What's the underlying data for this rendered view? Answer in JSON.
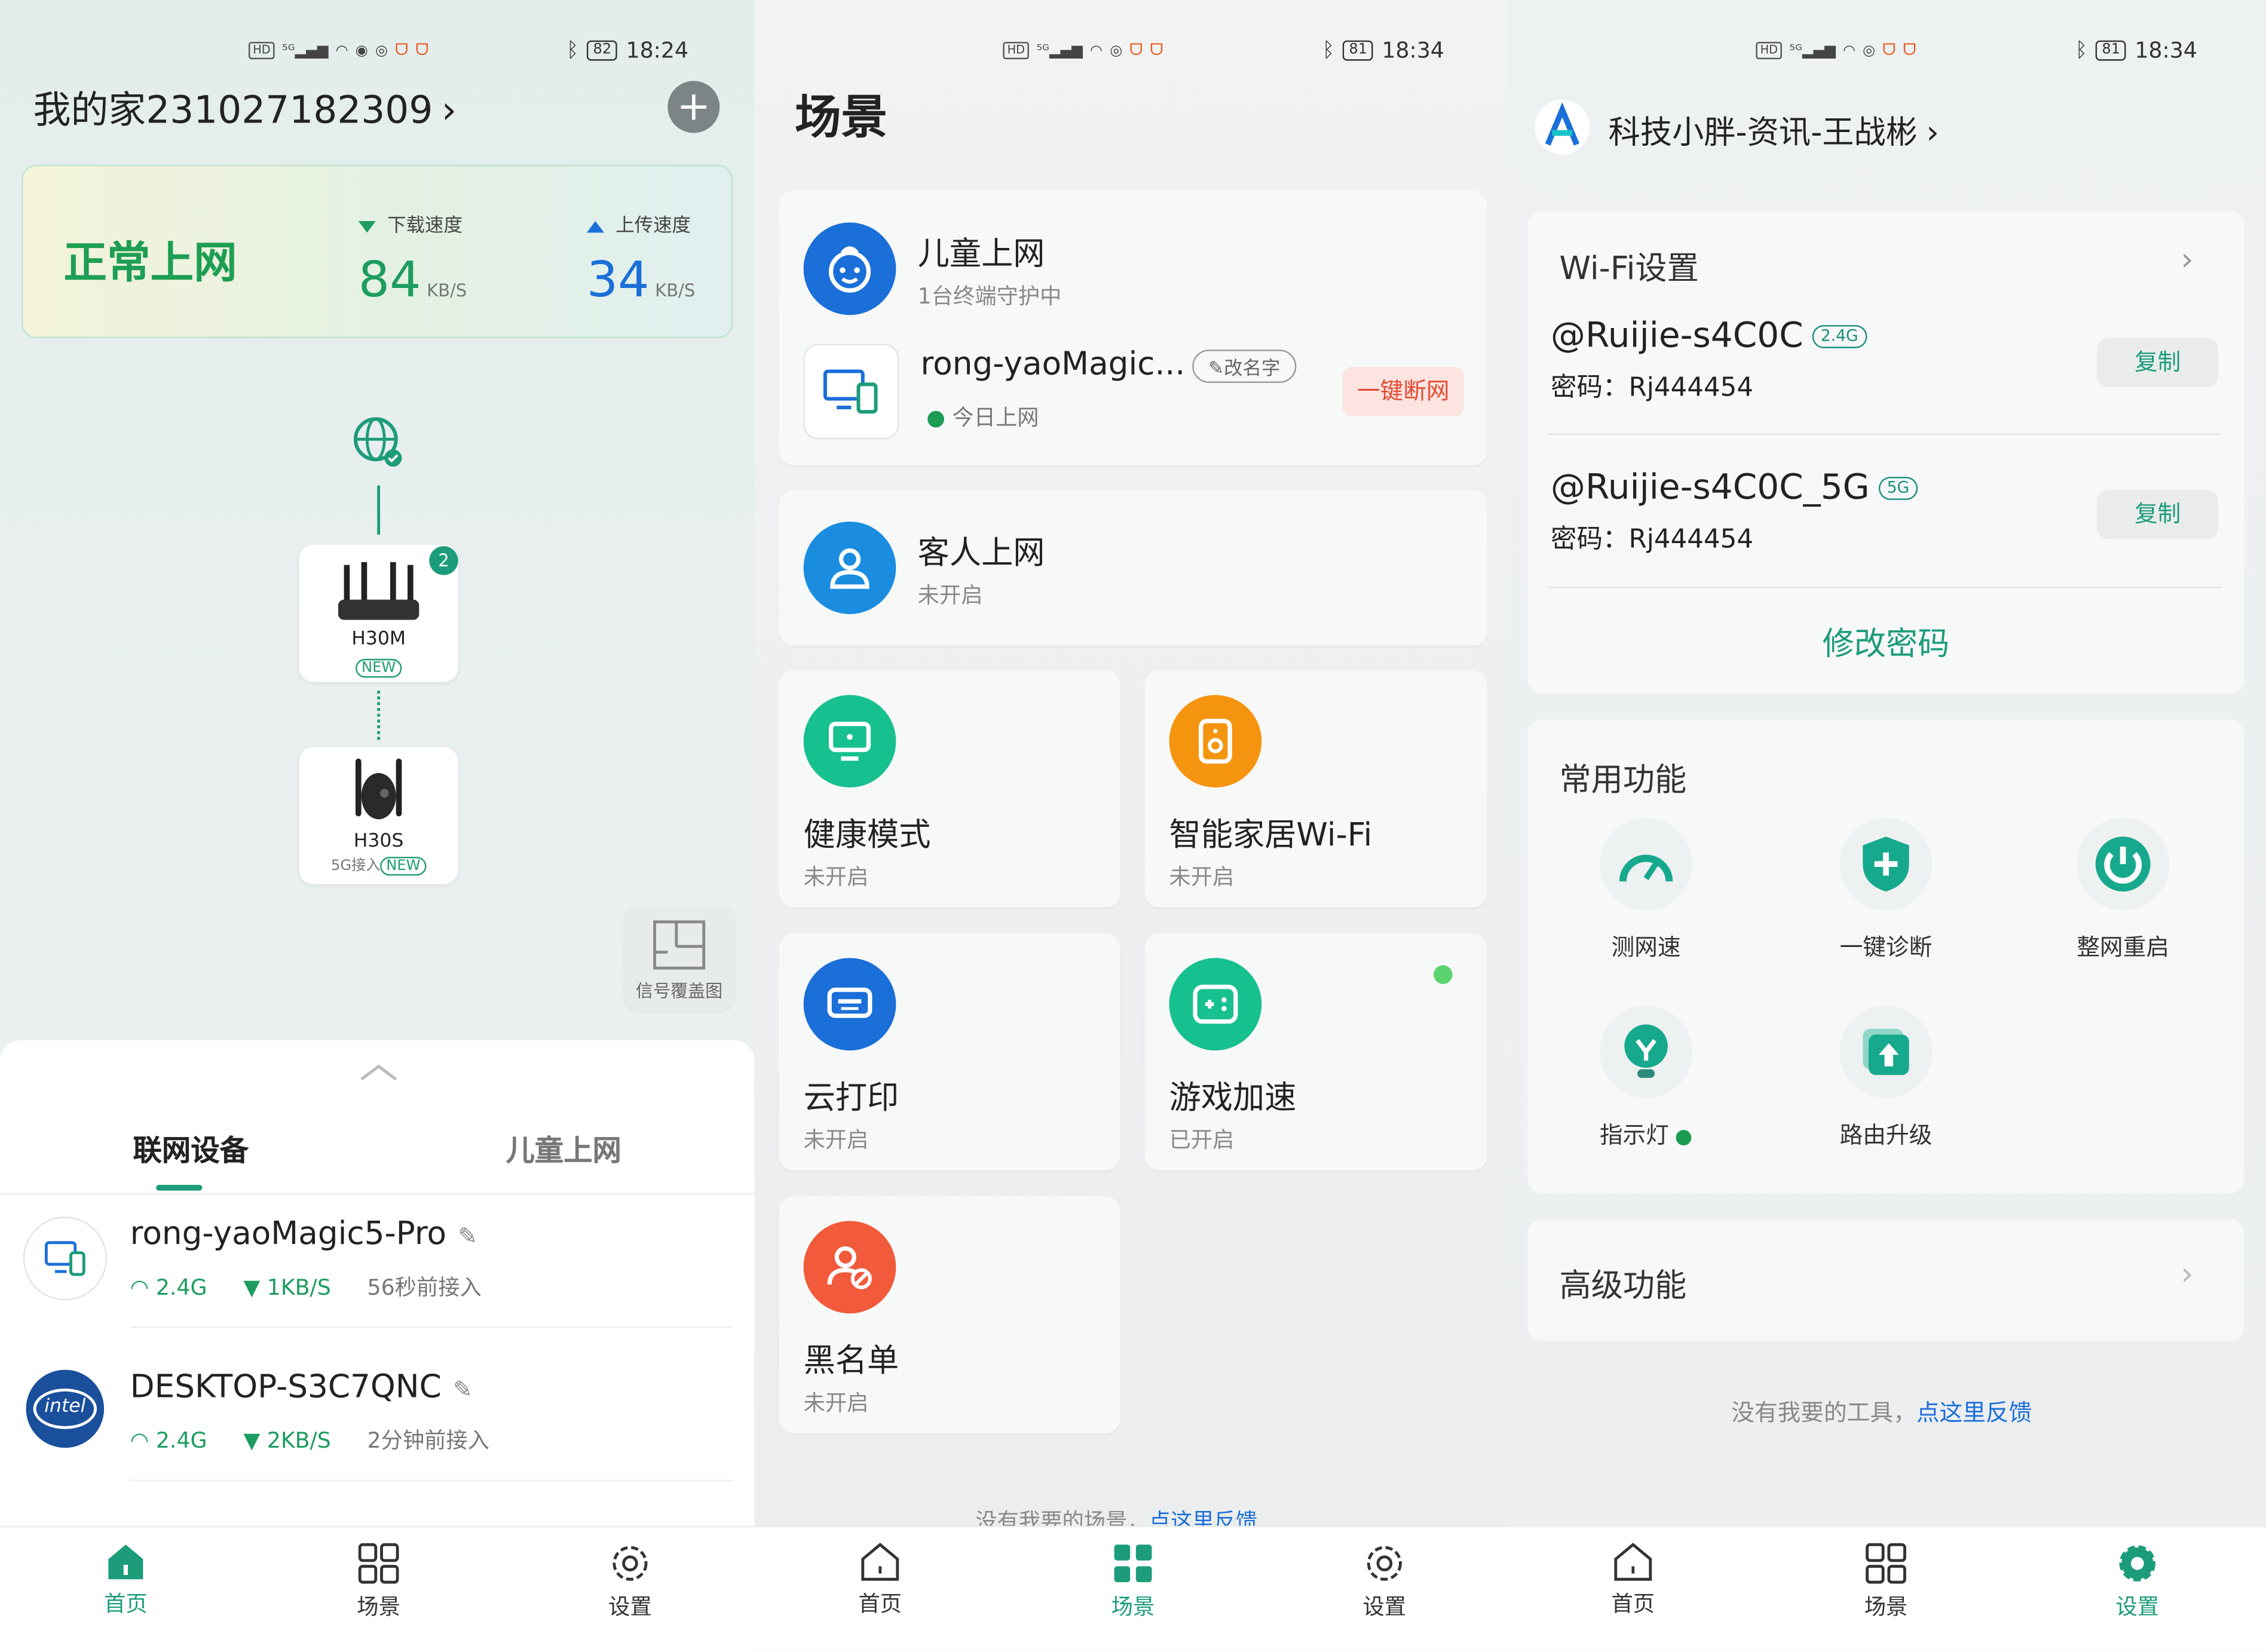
{
  "status_bar": {
    "left_indicators": "HD 5G",
    "panel1": {
      "battery": "82",
      "time": "18:24"
    },
    "panel2": {
      "battery": "81",
      "time": "18:34"
    },
    "panel3": {
      "battery": "81",
      "time": "18:34"
    }
  },
  "home": {
    "title": "我的家231027182309",
    "status_text": "正常上网",
    "download": {
      "label": "下载速度",
      "value": "84",
      "unit": "KB/S"
    },
    "upload": {
      "label": "上传速度",
      "value": "34",
      "unit": "KB/S"
    },
    "topology": {
      "main_router": {
        "name": "H30M",
        "tag": "NEW",
        "badge": "2"
      },
      "sub_router": {
        "name": "H30S",
        "link": "5G接入",
        "tag": "NEW"
      }
    },
    "coverage_map_label": "信号覆盖图",
    "tabs": [
      "联网设备",
      "儿童上网"
    ],
    "devices": [
      {
        "name": "rong-yaoMagic5-Pro",
        "band": "2.4G",
        "speed": "1KB/S",
        "time": "56秒前接入"
      },
      {
        "name": "DESKTOP-S3C7QNC",
        "band": "2.4G",
        "speed": "2KB/S",
        "time": "2分钟前接入",
        "logo_text": "intel"
      }
    ]
  },
  "scene": {
    "title": "场景",
    "child": {
      "title": "儿童上网",
      "subtitle": "1台终端守护中",
      "device_name": "rong-yaoMagic...",
      "rename": "改名字",
      "device_status": "今日上网",
      "disconnect": "一键断网"
    },
    "guest": {
      "title": "客人上网",
      "subtitle": "未开启"
    },
    "grid": [
      {
        "title": "健康模式",
        "subtitle": "未开启"
      },
      {
        "title": "智能家居Wi-Fi",
        "subtitle": "未开启"
      },
      {
        "title": "云打印",
        "subtitle": "未开启"
      },
      {
        "title": "游戏加速",
        "subtitle": "已开启"
      },
      {
        "title": "黑名单",
        "subtitle": "未开启"
      }
    ],
    "footer": {
      "text": "没有我要的场景，",
      "link": "点这里反馈"
    }
  },
  "settings": {
    "account": "科技小胖-资讯-王战彬",
    "wifi_title": "Wi-Fi设置",
    "networks": [
      {
        "ssid": "@Ruijie-s4C0C",
        "band": "2.4G",
        "password_label": "密码：",
        "password": "Rj444454",
        "copy": "复制"
      },
      {
        "ssid": "@Ruijie-s4C0C_5G",
        "band": "5G",
        "password_label": "密码：",
        "password": "Rj444454",
        "copy": "复制"
      }
    ],
    "change_password": "修改密码",
    "common_title": "常用功能",
    "functions": [
      {
        "label": "测网速",
        "icon": "speedometer-icon"
      },
      {
        "label": "一键诊断",
        "icon": "shield-plus-icon"
      },
      {
        "label": "整网重启",
        "icon": "power-icon"
      },
      {
        "label": "指示灯",
        "icon": "indicator-light-icon"
      },
      {
        "label": "路由升级",
        "icon": "upgrade-icon"
      }
    ],
    "advanced_title": "高级功能",
    "footer": {
      "text": "没有我要的工具，",
      "link": "点这里反馈"
    }
  },
  "nav": {
    "home": "首页",
    "scene": "场景",
    "settings": "设置"
  },
  "colors": {
    "accent": "#1c9c7a",
    "green": "#1e9e53",
    "blue": "#1a6fd8",
    "orange": "#f39c12",
    "red": "#f15a3a"
  }
}
